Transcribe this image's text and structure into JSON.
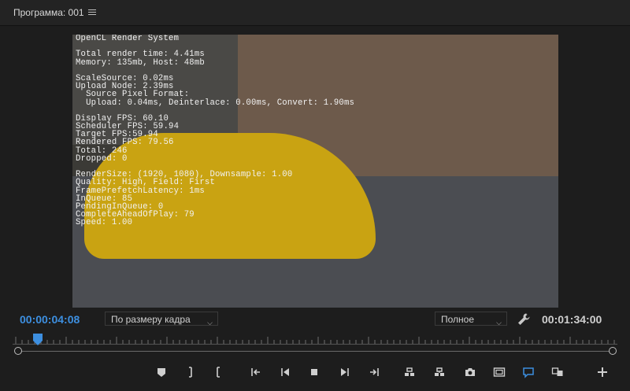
{
  "panel": {
    "title": "Программа: 001"
  },
  "monitor": {
    "overlay_lines": [
      "OpenCL Render System",
      "",
      "Total render time: 4.41ms",
      "Memory: 135mb, Host: 48mb",
      "",
      "ScaleSource: 0.02ms",
      "Upload Node: 2.39ms",
      "  Source Pixel Format:",
      "  Upload: 0.04ms, Deinterlace: 0.00ms, Convert: 1.90ms",
      "",
      "Display FPS: 60.10",
      "Scheduler FPS: 59.94",
      "Target FPS:59.94",
      "Rendered FPS: 79.56",
      "Total: 246",
      "Dropped: 0",
      "",
      "RenderSize: (1920, 1080), Downsample: 1.00",
      "Quality: High, Field: First",
      "FramePrefetchLatency: 1ms",
      "InQueue: 85",
      "PendingInQueue: 0",
      "CompleteAheadOfPlay: 79",
      "Speed: 1.00"
    ]
  },
  "controls": {
    "current_timecode": "00:00:04:08",
    "total_timecode": "00:01:34:00",
    "fit_dropdown": "По размеру кадра",
    "resolution_dropdown": "Полное",
    "accent_color": "#3d8fe0"
  },
  "transport": {
    "buttons": [
      "add-marker-icon",
      "mark-in-icon",
      "mark-out-icon",
      "go-to-in-icon",
      "step-back-icon",
      "stop-icon",
      "step-forward-icon",
      "go-to-out-icon",
      "lift-icon",
      "extract-icon",
      "export-frame-icon",
      "safe-margins-icon",
      "captions-icon",
      "comparison-view-icon",
      "button-editor-icon"
    ]
  }
}
